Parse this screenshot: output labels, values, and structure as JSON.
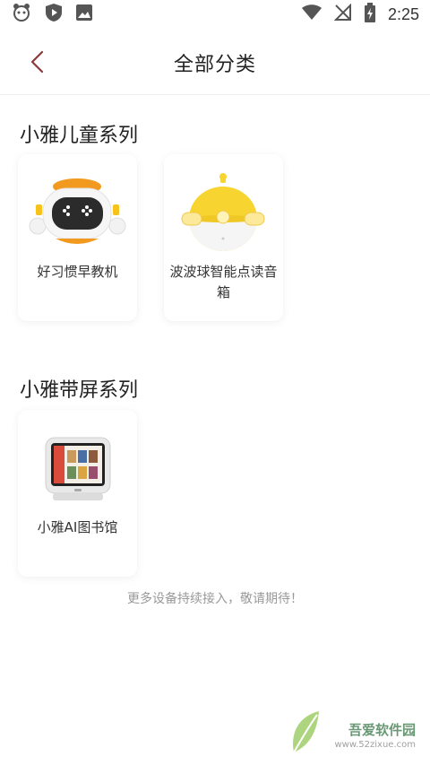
{
  "status_bar": {
    "time": "2:25"
  },
  "header": {
    "title": "全部分类"
  },
  "sections": [
    {
      "title": "小雅儿童系列",
      "items": [
        {
          "label": "好习惯早教机",
          "icon": "robot-device-icon"
        },
        {
          "label": "波波球智能点读音箱",
          "icon": "ball-speaker-icon"
        }
      ]
    },
    {
      "title": "小雅带屏系列",
      "items": [
        {
          "label": "小雅AI图书馆",
          "icon": "screen-device-icon"
        }
      ]
    }
  ],
  "footer_note": "更多设备持续接入，敬请期待！",
  "watermark": {
    "text": "吾爱软件园",
    "url": "www.52zixue.com"
  },
  "colors": {
    "accent_back": "#8b3a3a",
    "robot_orange": "#f29a1f",
    "ball_yellow": "#f7d430"
  }
}
